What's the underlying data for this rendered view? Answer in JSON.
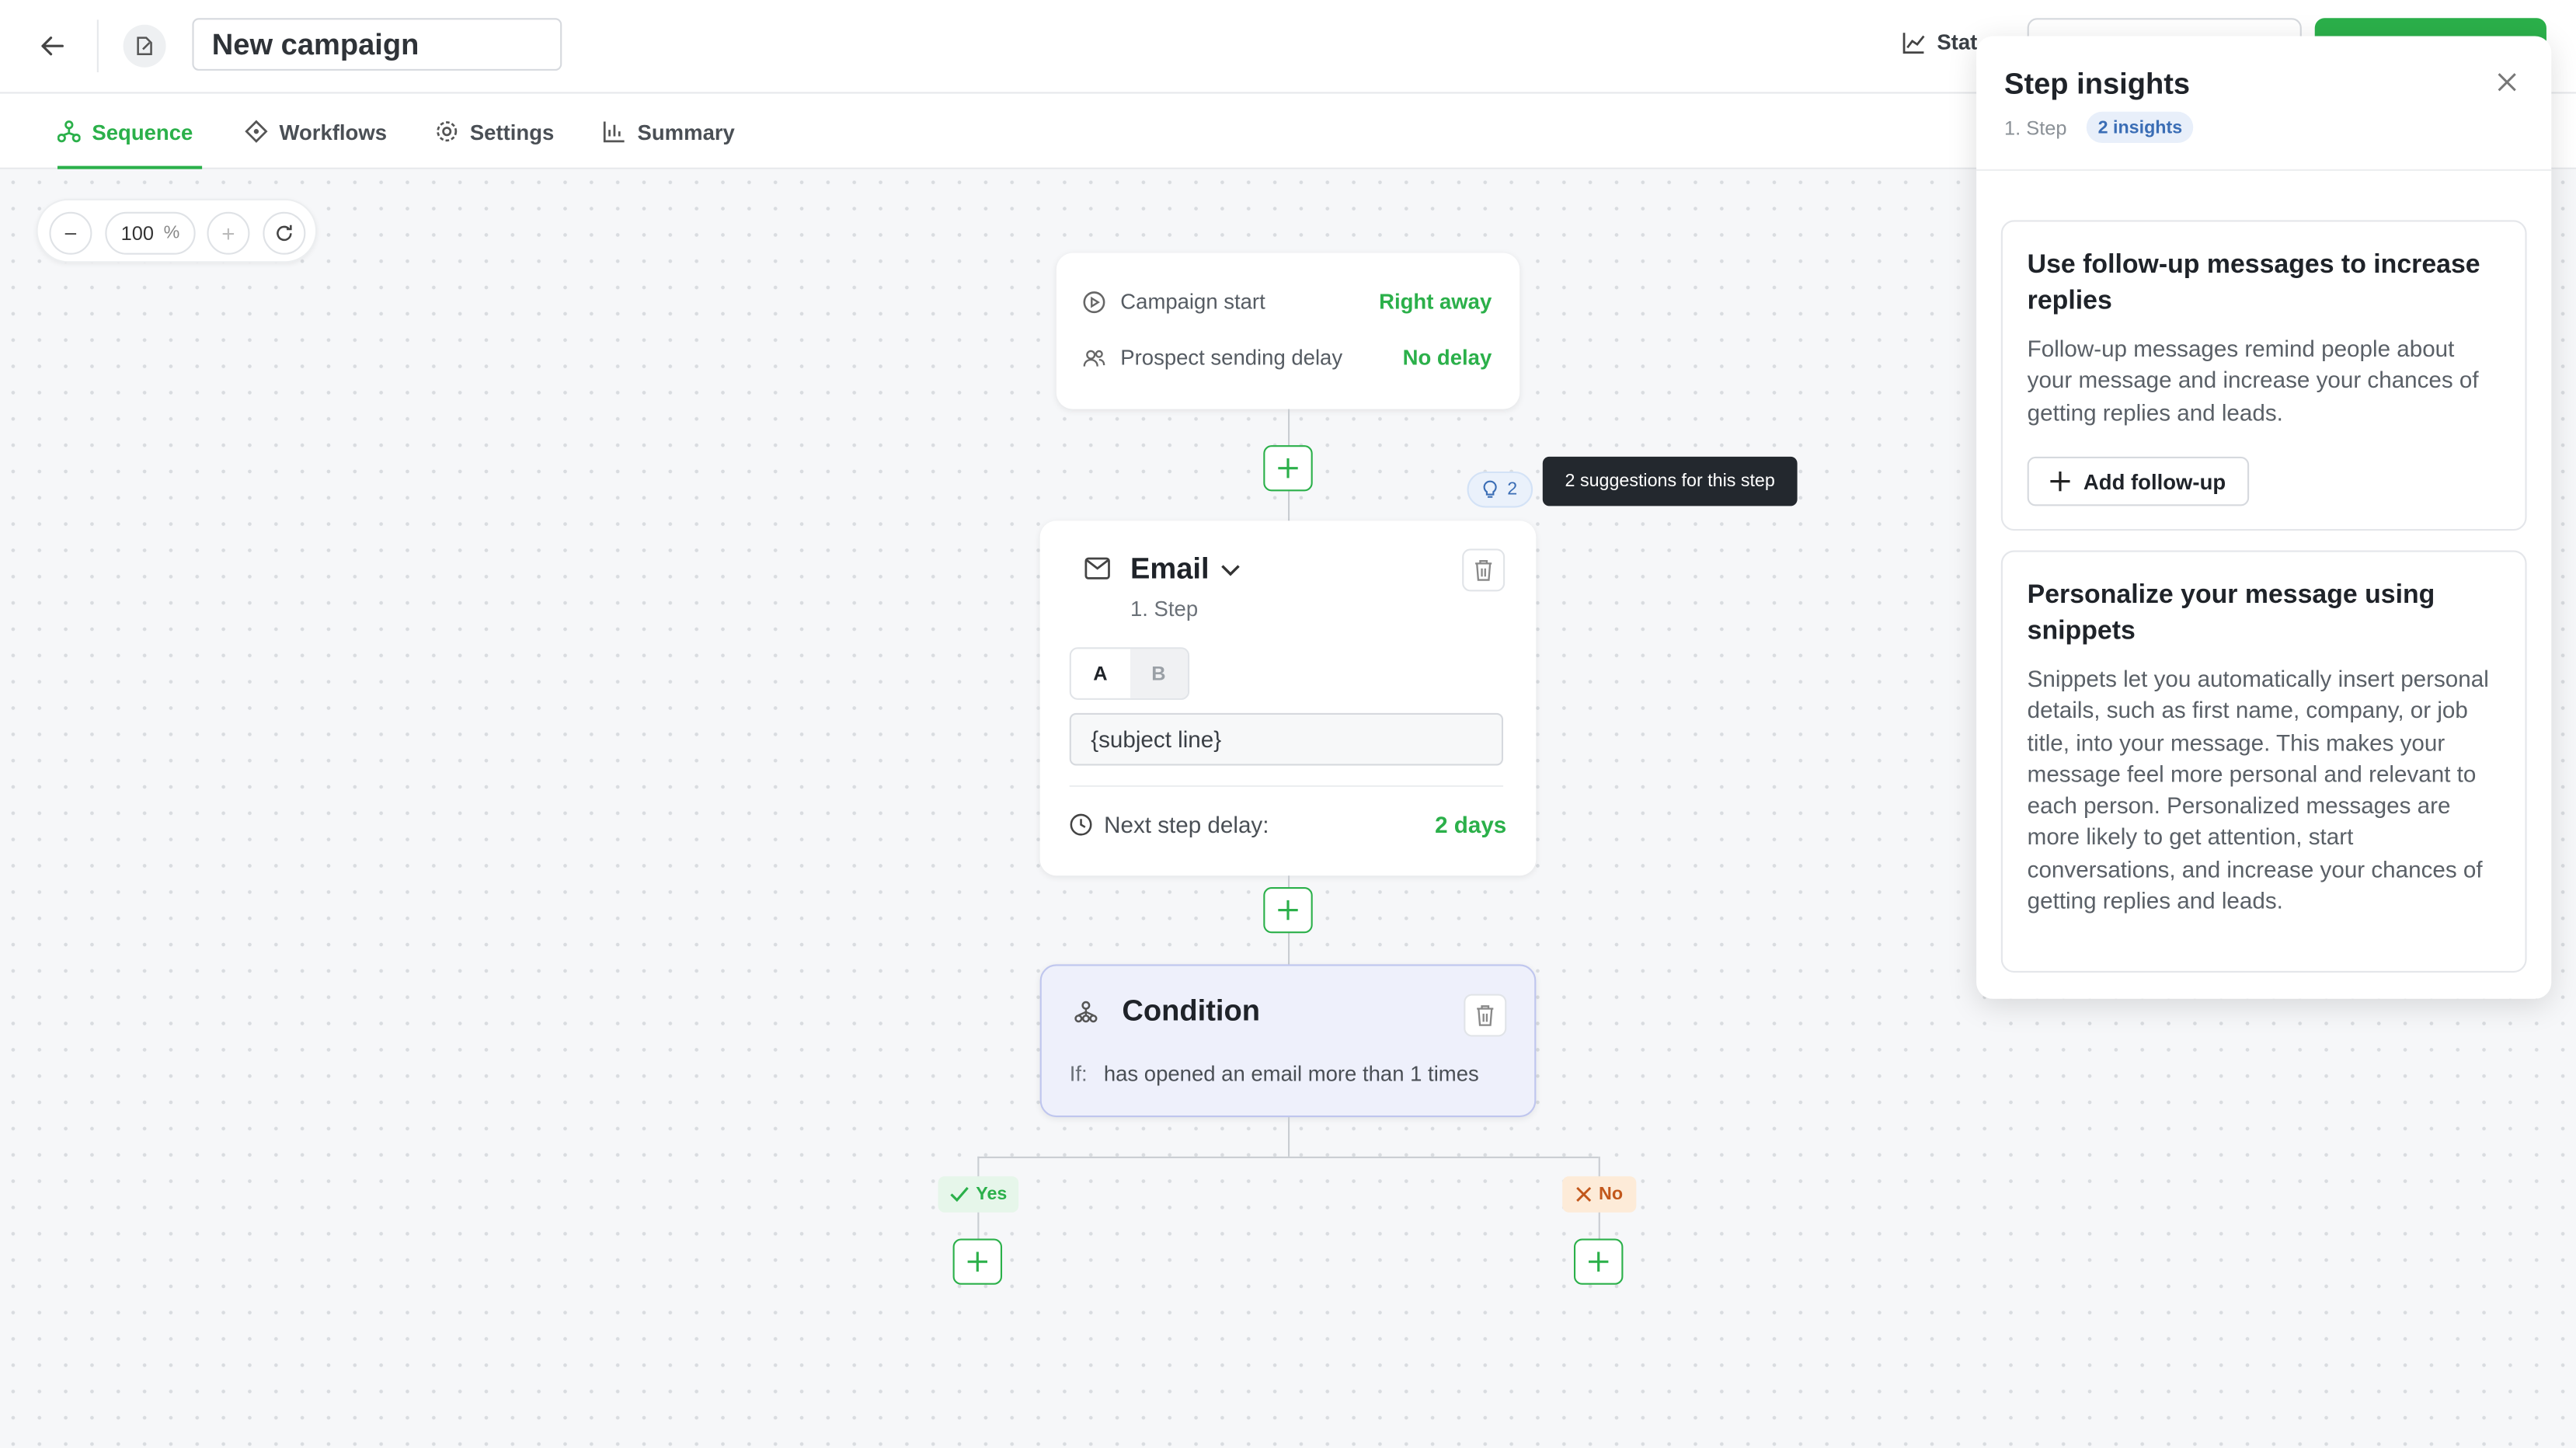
{
  "header": {
    "campaign_title": "New campaign",
    "stats_label": "Stat"
  },
  "tabs": [
    {
      "label": "Sequence",
      "icon": "sequence-icon"
    },
    {
      "label": "Workflows",
      "icon": "workflows-icon"
    },
    {
      "label": "Settings",
      "icon": "settings-icon"
    },
    {
      "label": "Summary",
      "icon": "summary-chart-icon"
    }
  ],
  "zoom": {
    "value": "100",
    "unit": "%"
  },
  "start_card": {
    "campaign_start_label": "Campaign start",
    "campaign_start_value": "Right away",
    "sending_delay_label": "Prospect sending delay",
    "sending_delay_value": "No delay"
  },
  "suggestions": {
    "count": "2",
    "tooltip": "2 suggestions for this step"
  },
  "email_step": {
    "title": "Email",
    "subtitle": "1. Step",
    "variant_a": "A",
    "variant_b": "B",
    "subject_value": "{subject line}",
    "next_delay_label": "Next step delay:",
    "next_delay_value": "2 days"
  },
  "condition_step": {
    "title": "Condition",
    "if_label": "If:",
    "if_text": "has opened an email more than 1 times",
    "yes_label": "Yes",
    "no_label": "No"
  },
  "insights_panel": {
    "title": "Step insights",
    "step_label": "1. Step",
    "badge": "2 insights",
    "insights": [
      {
        "title": "Use follow-up messages to increase replies",
        "body": "Follow-up messages remind people about your message and increase your chances of getting replies and leads.",
        "action": "Add follow-up"
      },
      {
        "title": "Personalize your message using snippets",
        "body": "Snippets let you automatically insert personal details, such as first name, company, or job title, into your message. This makes your message feel more personal and relevant to each person. Personalized messages are more likely to get attention, start conversations, and increase your chances of getting replies and leads."
      }
    ]
  },
  "colors": {
    "accent": "#2bb04a",
    "condition_bg": "#eef0fb",
    "no_tag": "#c2571b"
  }
}
